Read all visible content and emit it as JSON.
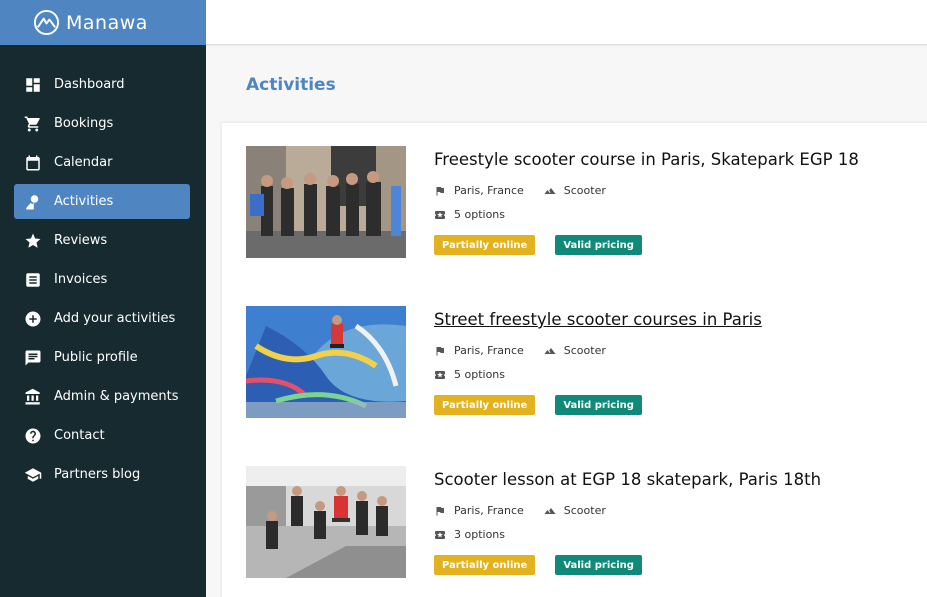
{
  "brand": {
    "name": "Manawa",
    "icon": "mountain-logo-icon"
  },
  "sidebar": {
    "items": [
      {
        "label": "Dashboard",
        "icon": "dashboard-icon"
      },
      {
        "label": "Bookings",
        "icon": "cart-icon"
      },
      {
        "label": "Calendar",
        "icon": "calendar-icon"
      },
      {
        "label": "Activities",
        "icon": "activities-icon",
        "active": true
      },
      {
        "label": "Reviews",
        "icon": "star-icon"
      },
      {
        "label": "Invoices",
        "icon": "invoice-icon"
      },
      {
        "label": "Add your activities",
        "icon": "add-circle-icon"
      },
      {
        "label": "Public profile",
        "icon": "message-icon"
      },
      {
        "label": "Admin & payments",
        "icon": "bank-icon"
      },
      {
        "label": "Contact",
        "icon": "help-icon"
      },
      {
        "label": "Partners blog",
        "icon": "school-icon"
      }
    ]
  },
  "page": {
    "title": "Activities"
  },
  "activities": [
    {
      "title": "Freestyle scooter course in Paris, Skatepark EGP 18",
      "location": "Paris, France",
      "sport": "Scooter",
      "options": "5 options",
      "badge_online": "Partially online",
      "badge_pricing": "Valid pricing"
    },
    {
      "title": "Street freestyle scooter courses in Paris",
      "location": "Paris, France",
      "sport": "Scooter",
      "options": "5 options",
      "badge_online": "Partially online",
      "badge_pricing": "Valid pricing"
    },
    {
      "title": "Scooter lesson at EGP 18 skatepark, Paris 18th",
      "location": "Paris, France",
      "sport": "Scooter",
      "options": "3 options",
      "badge_online": "Partially online",
      "badge_pricing": "Valid pricing"
    }
  ],
  "colors": {
    "sidebar_bg": "#162a30",
    "brand_bg": "#4f86c1",
    "accent": "#4f86c1",
    "badge_online": "#e3b21f",
    "badge_pricing": "#0f8a78"
  }
}
